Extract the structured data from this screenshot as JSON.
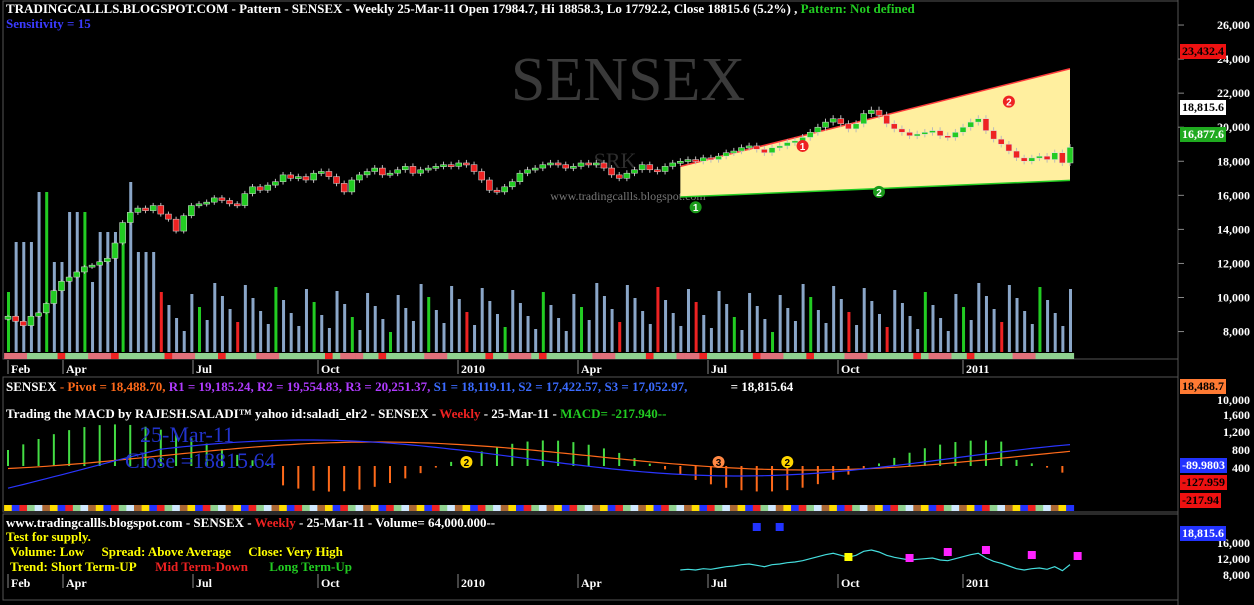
{
  "main_header": {
    "site": "TRADINGCALLLS.BLOGSPOT.COM",
    "sep": " - ",
    "pattern_word": "Pattern",
    "desc": " - SENSEX - Weekly 25-Mar-11 Open 17984.7, Hi 18858.3, Lo 17792.2, Close 18815.6 (5.2%) ,",
    "pattern_status": "Pattern: Not defined",
    "sensitivity": "Sensitivity = 15"
  },
  "watermark": {
    "big": "SENSEX",
    "small": "SRK",
    "url": "www.tradingcallls.blogspot.com"
  },
  "badges": {
    "upper": "23,432.4",
    "close": "18,815.6",
    "lower": "16,877.6",
    "pivot": "18,488.7",
    "macd_val": "-89.9803",
    "macd_sig": "-127.959",
    "macd_hist": "-217.94",
    "vol_close": "18,815.6"
  },
  "colors": {
    "up": "#22cc22",
    "down": "#ee2222",
    "channel_fill": "#ffef9f",
    "channel_edge": "#ff3b3b",
    "vol_base": "#8aa6c8",
    "macd_line": "#2a35ff",
    "signal_line": "#ff6a1a"
  },
  "pivot_line": {
    "name": "SENSEX",
    "pivot": " - Pivot = 18,488.70,",
    "r1": "R1 = 19,185.24,",
    "r2": "R2 = 19,554.83,",
    "r3": "R3 = 20,251.37,",
    "s1": "S1 = 18,119.11,",
    "s2": "S2 = 17,422.57,",
    "s3": "S3 = 17,052.97,",
    "last": "= 18,815.64"
  },
  "macd_header": {
    "title": "Trading the MACD by RAJESH.SALADI™ yahoo id:saladi_elr2 - SENSEX -",
    "weekly": "Weekly",
    "date": " - 25-Mar-11 -",
    "macd": "MACD= -217.940--",
    "overlay_date": "25-Mar-11",
    "overlay_close": "Close =18815.64"
  },
  "volume_panel": {
    "header_pre": "www.tradingcallls.blogspot.com - SENSEX -",
    "weekly": "Weekly",
    "header_mid": " - 25-Mar-11 - Volume= 64,000.000--",
    "test": "Test for supply.",
    "volume_lbl": "Volume: Low",
    "spread_lbl": "Spread: Above Average",
    "close_lbl": "Close: Very High",
    "trend_lbl": "Trend: Short Term-UP",
    "mid_lbl": "Mid Term-Down",
    "long_lbl": "Long Term-Up"
  },
  "months": [
    "Feb",
    "Apr",
    "Jul",
    "Oct",
    "2010",
    "Apr",
    "Jul",
    "Oct",
    "2011"
  ],
  "months_bottom": [
    "Feb",
    "Apr",
    "Jul",
    "Oct",
    "2010",
    "Apr",
    "Jul",
    "Oct",
    "2011"
  ],
  "price_ticks": [
    "26,000",
    "24,000",
    "22,000",
    "20,000",
    "18,000",
    "16,000",
    "14,000",
    "12,000",
    "10,000",
    "8,000"
  ],
  "macd_ticks": [
    "10,000",
    "1,600",
    "1,200",
    "800",
    "400"
  ],
  "vol_ticks": [
    "16,000",
    "12,000",
    "8,000"
  ],
  "pattern_markers": [
    "1",
    "1",
    "2",
    "2"
  ],
  "chart_data": {
    "type": "candlestick",
    "title": "SENSEX Weekly",
    "ylim": [
      6800,
      27000
    ],
    "weeks_close": [
      8900,
      8600,
      8350,
      8900,
      9100,
      9650,
      10400,
      10950,
      11200,
      11500,
      11800,
      11900,
      12100,
      12300,
      13200,
      14400,
      15000,
      15250,
      15100,
      15400,
      14900,
      14600,
      13900,
      14800,
      15400,
      15500,
      15600,
      15850,
      15700,
      15500,
      15400,
      16100,
      16500,
      16300,
      16600,
      16800,
      17200,
      17000,
      17100,
      16900,
      17300,
      17400,
      17100,
      16700,
      16200,
      16900,
      17200,
      17400,
      17600,
      17200,
      17300,
      17500,
      17700,
      17300,
      17500,
      17600,
      17700,
      17800,
      17700,
      17900,
      17800,
      17400,
      16900,
      16300,
      16200,
      16500,
      16800,
      17300,
      17500,
      17600,
      17800,
      17900,
      17800,
      17600,
      17700,
      17900,
      17800,
      17900,
      17600,
      17200,
      17000,
      17300,
      17500,
      17800,
      17500,
      17400,
      17700,
      17900,
      18000,
      18100,
      18000,
      18200,
      18100,
      18300,
      18500,
      18600,
      18800,
      18900,
      18700,
      18500,
      18800,
      18900,
      19100,
      19200,
      19400,
      19700,
      20000,
      20300,
      20500,
      20200,
      19900,
      20200,
      20800,
      21000,
      20700,
      20200,
      19900,
      19700,
      19500,
      19600,
      19700,
      19800,
      19500,
      19400,
      19700,
      20000,
      20300,
      20500,
      19800,
      19300,
      19000,
      18600,
      18200,
      18000,
      18200,
      18300,
      18100,
      18500,
      17900,
      18815.6
    ],
    "channel": {
      "upper_start": 17700,
      "upper_end": 23432.4,
      "lower_start": 15900,
      "lower_end": 16877.6
    },
    "pivot": 18488.7,
    "r1": 19185.24,
    "r2": 19554.83,
    "r3": 20251.37,
    "s1": 18119.11,
    "s2": 17422.57,
    "s3": 17052.97,
    "last_close": 18815.6,
    "macd": -217.94,
    "volume": 64000
  }
}
